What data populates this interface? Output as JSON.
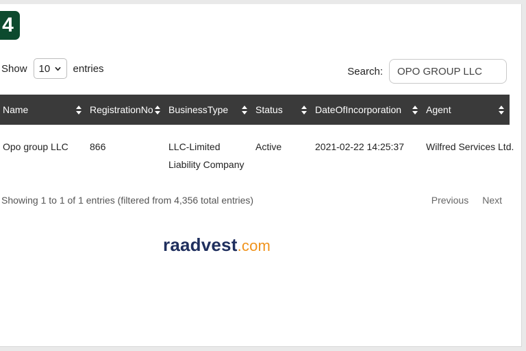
{
  "badge": {
    "text": "4"
  },
  "length_control": {
    "show_label": "Show",
    "selected": "10",
    "entries_label": "entries"
  },
  "search": {
    "label": "Search:",
    "value": "OPO GROUP LLC"
  },
  "table": {
    "headers": [
      "Name",
      "RegistrationNo",
      "BusinessType",
      "Status",
      "DateOfIncorporation",
      "Agent"
    ],
    "rows": [
      {
        "name": "Opo group LLC",
        "registration_no": "866",
        "business_type": "LLC-Limited Liability Company",
        "status": "Active",
        "date_of_incorporation": "2021-02-22 14:25:37",
        "agent": "Wilfred Services Ltd."
      }
    ]
  },
  "info": "Showing 1 to 1 of 1 entries (filtered from 4,356 total entries)",
  "pager": {
    "previous": "Previous",
    "next": "Next"
  },
  "brand": {
    "name": "raadvest",
    "suffix": ".com"
  },
  "colors": {
    "header_bg": "#3a3a3a",
    "badge_bg": "#0d4a2e",
    "brand_navy": "#1f2f5e",
    "brand_orange": "#f0931c"
  }
}
